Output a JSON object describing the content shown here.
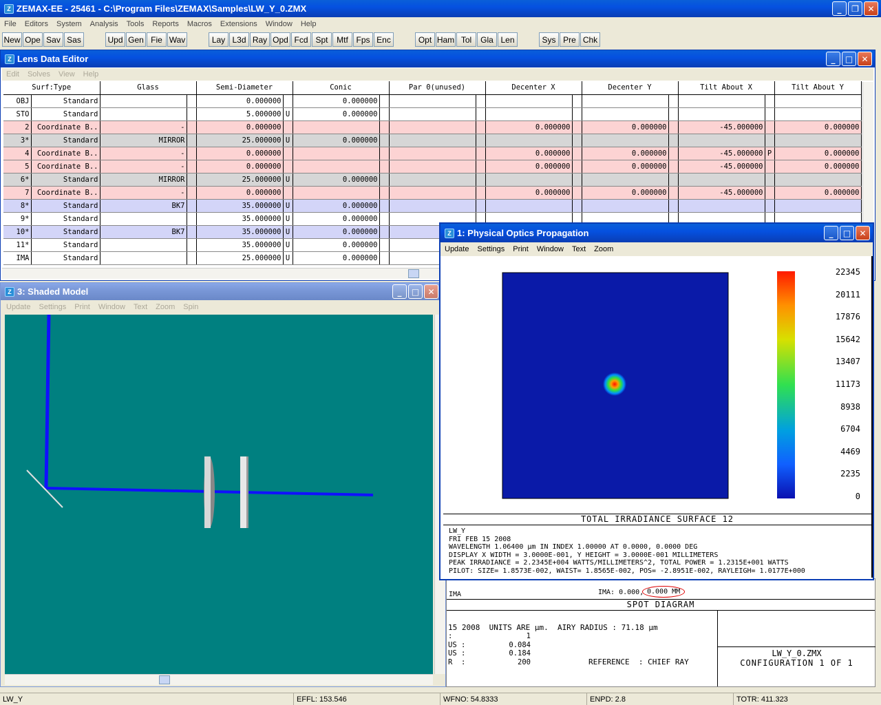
{
  "app": {
    "title": "ZEMAX-EE - 25461 - C:\\Program Files\\ZEMAX\\Samples\\LW_Y_0.ZMX"
  },
  "menubar": [
    "File",
    "Editors",
    "System",
    "Analysis",
    "Tools",
    "Reports",
    "Macros",
    "Extensions",
    "Window",
    "Help"
  ],
  "toolbar": [
    "New",
    "Ope",
    "Sav",
    "Sas",
    "Upd",
    "Gen",
    "Fie",
    "Wav",
    "Lay",
    "L3d",
    "Ray",
    "Opd",
    "Fcd",
    "Spt",
    "Mtf",
    "Fps",
    "Enc",
    "Opt",
    "Ham",
    "Tol",
    "Gla",
    "Len",
    "Sys",
    "Pre",
    "Chk"
  ],
  "lde": {
    "title": "Lens Data Editor",
    "menu": [
      "Edit",
      "Solves",
      "View",
      "Help"
    ],
    "headers": [
      "Surf:Type",
      "Glass",
      "Semi-Diameter",
      "Conic",
      "Par 0(unused)",
      "Decenter X",
      "Decenter Y",
      "Tilt About X",
      "Tilt About Y"
    ],
    "rows": [
      {
        "surf": "OBJ",
        "type": "Standard",
        "glass": "",
        "sd": "0.000000",
        "sds": "",
        "conic": "0.000000",
        "dx": "",
        "dy": "",
        "tx": "",
        "txs": "",
        "ty": "",
        "bg": "#ffffff"
      },
      {
        "surf": "STO",
        "type": "Standard",
        "glass": "",
        "sd": "5.000000",
        "sds": "U",
        "conic": "0.000000",
        "dx": "",
        "dy": "",
        "tx": "",
        "txs": "",
        "ty": "",
        "bg": "#ffffff"
      },
      {
        "surf": "2",
        "type": "Coordinate B..",
        "glass": "-",
        "sd": "0.000000",
        "sds": "",
        "conic": "",
        "dx": "0.000000",
        "dy": "0.000000",
        "tx": "-45.000000",
        "txs": "",
        "ty": "0.000000",
        "bg": "#fcd3d3"
      },
      {
        "surf": "3*",
        "type": "Standard",
        "glass": "MIRROR",
        "sd": "25.000000",
        "sds": "U",
        "conic": "0.000000",
        "dx": "",
        "dy": "",
        "tx": "",
        "txs": "",
        "ty": "",
        "bg": "#d6d6d6"
      },
      {
        "surf": "4",
        "type": "Coordinate B..",
        "glass": "-",
        "sd": "0.000000",
        "sds": "",
        "conic": "",
        "dx": "0.000000",
        "dy": "0.000000",
        "tx": "-45.000000",
        "txs": "P",
        "ty": "0.000000",
        "bg": "#fcd3d3"
      },
      {
        "surf": "5",
        "type": "Coordinate B..",
        "glass": "-",
        "sd": "0.000000",
        "sds": "",
        "conic": "",
        "dx": "0.000000",
        "dy": "0.000000",
        "tx": "-45.000000",
        "txs": "",
        "ty": "0.000000",
        "bg": "#fcd3d3"
      },
      {
        "surf": "6*",
        "type": "Standard",
        "glass": "MIRROR",
        "sd": "25.000000",
        "sds": "U",
        "conic": "0.000000",
        "dx": "",
        "dy": "",
        "tx": "",
        "txs": "",
        "ty": "",
        "bg": "#d6d6d6"
      },
      {
        "surf": "7",
        "type": "Coordinate B..",
        "glass": "-",
        "sd": "0.000000",
        "sds": "",
        "conic": "",
        "dx": "0.000000",
        "dy": "0.000000",
        "tx": "-45.000000",
        "txs": "",
        "ty": "0.000000",
        "bg": "#fcd3d3"
      },
      {
        "surf": "8*",
        "type": "Standard",
        "glass": "BK7",
        "sd": "35.000000",
        "sds": "U",
        "conic": "0.000000",
        "dx": "",
        "dy": "",
        "tx": "",
        "txs": "",
        "ty": "",
        "bg": "#d3d5f8"
      },
      {
        "surf": "9*",
        "type": "Standard",
        "glass": "",
        "sd": "35.000000",
        "sds": "U",
        "conic": "0.000000",
        "dx": "",
        "dy": "",
        "tx": "",
        "txs": "",
        "ty": "",
        "bg": "#ffffff"
      },
      {
        "surf": "10*",
        "type": "Standard",
        "glass": "BK7",
        "sd": "35.000000",
        "sds": "U",
        "conic": "0.000000",
        "dx": "",
        "dy": "",
        "tx": "",
        "txs": "",
        "ty": "",
        "bg": "#d3d5f8"
      },
      {
        "surf": "11*",
        "type": "Standard",
        "glass": "",
        "sd": "35.000000",
        "sds": "U",
        "conic": "0.000000",
        "dx": "",
        "dy": "",
        "tx": "",
        "txs": "",
        "ty": "",
        "bg": "#ffffff"
      },
      {
        "surf": "IMA",
        "type": "Standard",
        "glass": "",
        "sd": "25.000000",
        "sds": "U",
        "conic": "0.000000",
        "dx": "",
        "dy": "",
        "tx": "",
        "txs": "",
        "ty": "",
        "bg": "#ffffff"
      }
    ]
  },
  "shaded": {
    "title": "3: Shaded Model",
    "menu": [
      "Update",
      "Settings",
      "Print",
      "Window",
      "Text",
      "Zoom",
      "Spin"
    ]
  },
  "pop": {
    "title": "1: Physical Optics Propagation",
    "menu": [
      "Update",
      "Settings",
      "Print",
      "Window",
      "Text",
      "Zoom"
    ],
    "scale": [
      "22345",
      "20111",
      "17876",
      "15642",
      "13407",
      "11173",
      "8938",
      "6704",
      "4469",
      "2235",
      "0"
    ],
    "caption": "TOTAL IRRADIANCE SURFACE 12",
    "info": [
      "LW_Y",
      "FRI FEB 15 2008",
      "WAVELENGTH 1.06400 µm IN INDEX 1.00000 AT 0.0000, 0.0000 DEG",
      "DISPLAY X WIDTH = 3.0000E-001, Y HEIGHT = 3.0000E-001 MILLIMETERS",
      "PEAK IRRADIANCE = 2.2345E+004 WATTS/MILLIMETERS^2, TOTAL POWER = 1.2315E+001 WATTS",
      "PILOT: SIZE= 1.8573E-002, WAIST= 1.8565E-002, POS= -2.8951E-002, RAYLEIGH= 1.0177E+000"
    ]
  },
  "spot": {
    "ima_label": "IMA",
    "ima_coords": "IMA: 0.000,",
    "ima_circled": "0.000 MM",
    "caption": "SPOT DIAGRAM",
    "units_line": "15 2008  UNITS ARE µm.  AIRY RADIUS : 71.18 µm",
    "rows": [
      {
        "k": ":",
        "v": "1"
      },
      {
        "k": "US :",
        "v": "0.084"
      },
      {
        "k": "US :",
        "v": "0.184"
      },
      {
        "k": "R  :",
        "v": "200"
      }
    ],
    "reference": "REFERENCE  : CHIEF RAY",
    "file": "LW_Y_0.ZMX",
    "config": "CONFIGURATION 1 OF 1"
  },
  "status": {
    "a": "LW_Y",
    "b": "EFFL: 153.546",
    "c": "WFNO: 54.8333",
    "d": "ENPD: 2.8",
    "e": "TOTR: 411.323"
  }
}
